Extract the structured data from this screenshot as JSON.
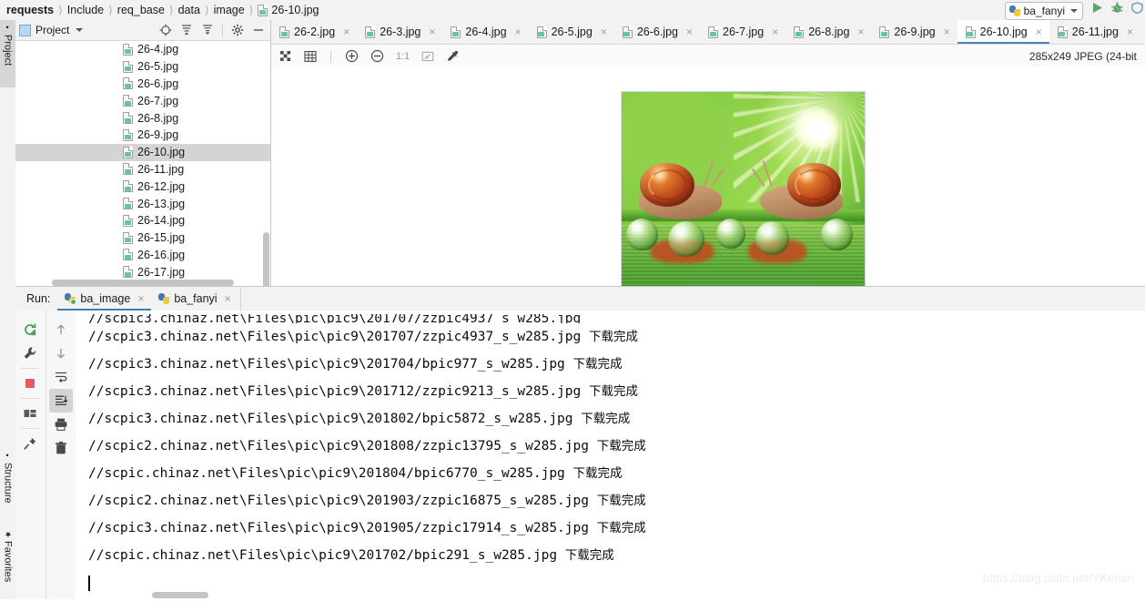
{
  "breadcrumb": {
    "items": [
      "requests",
      "Include",
      "req_base",
      "data",
      "image"
    ],
    "file": "26-10.jpg"
  },
  "toolbar": {
    "run_config": "ba_fanyi",
    "run_button": "run-icon",
    "debug_button": "debug-icon",
    "coverage_button": "coverage-icon"
  },
  "rail": {
    "project": "Project",
    "structure": "Structure",
    "favorites": "Favorites"
  },
  "project_panel": {
    "title": "Project",
    "files": [
      {
        "name": "26-4.jpg",
        "selected": false
      },
      {
        "name": "26-5.jpg",
        "selected": false
      },
      {
        "name": "26-6.jpg",
        "selected": false
      },
      {
        "name": "26-7.jpg",
        "selected": false
      },
      {
        "name": "26-8.jpg",
        "selected": false
      },
      {
        "name": "26-9.jpg",
        "selected": false
      },
      {
        "name": "26-10.jpg",
        "selected": true
      },
      {
        "name": "26-11.jpg",
        "selected": false
      },
      {
        "name": "26-12.jpg",
        "selected": false
      },
      {
        "name": "26-13.jpg",
        "selected": false
      },
      {
        "name": "26-14.jpg",
        "selected": false
      },
      {
        "name": "26-15.jpg",
        "selected": false
      },
      {
        "name": "26-16.jpg",
        "selected": false
      },
      {
        "name": "26-17.jpg",
        "selected": false
      }
    ]
  },
  "editor": {
    "tabs": [
      {
        "label": "26-2.jpg",
        "active": false
      },
      {
        "label": "26-3.jpg",
        "active": false
      },
      {
        "label": "26-4.jpg",
        "active": false
      },
      {
        "label": "26-5.jpg",
        "active": false
      },
      {
        "label": "26-6.jpg",
        "active": false
      },
      {
        "label": "26-7.jpg",
        "active": false
      },
      {
        "label": "26-8.jpg",
        "active": false
      },
      {
        "label": "26-9.jpg",
        "active": false
      },
      {
        "label": "26-10.jpg",
        "active": true
      },
      {
        "label": "26-11.jpg",
        "active": false
      }
    ],
    "close_glyph": "×",
    "image_tools": [
      "transparency-grid-icon",
      "pixel-grid-icon",
      "zoom-in-icon",
      "zoom-out-icon",
      "actual-size-icon",
      "fit-to-window-icon",
      "color-picker-icon"
    ],
    "actual_size_label": "1:1",
    "image_info": "285x249 JPEG (24-bit",
    "image_alt": "two-snails-on-dewy-grass-photo"
  },
  "run_panel": {
    "label": "Run:",
    "tabs": [
      {
        "label": "ba_image",
        "active": true,
        "running": true
      },
      {
        "label": "ba_fanyi",
        "active": false,
        "running": false
      }
    ],
    "close_glyph": "×",
    "side_tools_left": [
      "rerun-icon",
      "settings-wrench-icon",
      "stop-icon",
      "layout-icon",
      "pin-icon"
    ],
    "side_tools_right": [
      "scroll-up-icon",
      "scroll-down-icon",
      "soft-wrap-icon",
      "scroll-to-end-icon",
      "print-icon",
      "trash-icon"
    ],
    "console_lines": [
      {
        "path": "//scpic3.chinaz.net\\Files\\pic\\pic9\\201707/zzpic4937_s_w285.jpg",
        "status": "下载完成"
      },
      {
        "path": "//scpic3.chinaz.net\\Files\\pic\\pic9\\201704/bpic977_s_w285.jpg",
        "status": "下载完成"
      },
      {
        "path": "//scpic3.chinaz.net\\Files\\pic\\pic9\\201712/zzpic9213_s_w285.jpg",
        "status": "下载完成"
      },
      {
        "path": "//scpic3.chinaz.net\\Files\\pic\\pic9\\201802/bpic5872_s_w285.jpg",
        "status": "下载完成"
      },
      {
        "path": "//scpic2.chinaz.net\\Files\\pic\\pic9\\201808/zzpic13795_s_w285.jpg",
        "status": "下载完成"
      },
      {
        "path": "//scpic.chinaz.net\\Files\\pic\\pic9\\201804/bpic6770_s_w285.jpg",
        "status": "下载完成"
      },
      {
        "path": "//scpic2.chinaz.net\\Files\\pic\\pic9\\201903/zzpic16875_s_w285.jpg",
        "status": "下载完成"
      },
      {
        "path": "//scpic3.chinaz.net\\Files\\pic\\pic9\\201905/zzpic17914_s_w285.jpg",
        "status": "下载完成"
      },
      {
        "path": "//scpic.chinaz.net\\Files\\pic\\pic9\\201702/bpic291_s_w285.jpg",
        "status": "下载完成"
      }
    ]
  },
  "watermark": "https://blog.csdn.net/YKenan",
  "colors": {
    "accent": "#3c7fb1",
    "run_green": "#59a869",
    "stop_red": "#e05b5b",
    "selection_gray": "#d4d4d4",
    "panel_gray": "#f2f2f2"
  }
}
